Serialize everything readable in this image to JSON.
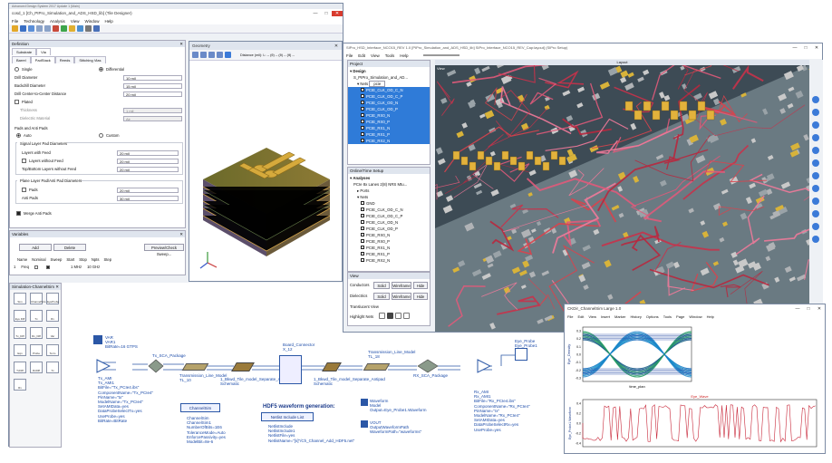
{
  "main": {
    "title": "cosd_1 [Ch_PIPro_Simulation_and_ADS_HSD_lib] (Tile Designer)",
    "app_title": "Advanced Design System 2017 Update 1 (Main)",
    "menu": [
      "File",
      "Technology",
      "Analysis",
      "View",
      "Window",
      "Help"
    ]
  },
  "definition": {
    "header": "Definition",
    "tabs": [
      "Substrate",
      "Via"
    ],
    "subtabs": [
      "Barrel",
      "PadStack",
      "Reeds",
      "Stitching Vias"
    ],
    "single_label": "Single",
    "differential_label": "Differential",
    "drill_diameter_label": "Drill Diameter",
    "drill_diameter_value": "10 mil",
    "backdrill_label": "Backdrill Diameter",
    "backdrill_value": "15 mil",
    "drill_center_label": "Drill Center-to-Center Distance",
    "drill_center_value": "20 mil",
    "plated_label": "Plated",
    "thickness_label": "Thickness",
    "thickness_value": "1 mil",
    "dielectric_label": "Dielectric Material",
    "dielectric_value": "Air",
    "pads_header": "Pads and Anti Pads",
    "auto_label": "Auto",
    "custom_label": "Custom",
    "signal_pads_header": "Signal Layer Pad Diameters",
    "layers_with_feed_label": "Layers with Feed",
    "layers_with_feed_value": "20 mil",
    "layers_without_feed_label": "Layers without Feed",
    "layers_without_feed_value": "20 mil",
    "topbottom_label": "Top/Bottom Layers without Feed",
    "topbottom_value": "20 mil",
    "plane_header": "Plane Layer Pad/Anti Pad Diameters",
    "pads_label": "Pads",
    "pads_value": "20 mil",
    "antipads_label": "Anti Pads",
    "antipads_value": "30 mil",
    "merge_label": "Merge Anti Pads"
  },
  "variables": {
    "header": "Variables",
    "add_label": "Add",
    "delete_label": "Delete",
    "preview_label": "Preview/Check Sweep...",
    "columns": [
      "Name",
      "Nominal",
      "Sweep",
      "Start",
      "Stop",
      "Npts",
      "Step"
    ],
    "row": [
      "Freq",
      "",
      "",
      "1 MHz",
      "10 GHz",
      "",
      " "
    ]
  },
  "palette": {
    "header": "Simulation-ChannelSim",
    "items": [
      "Sim",
      "ChannelSim",
      "EyeProbe",
      "Eye Diff",
      "Tx",
      "Rx",
      "Tx_Diff",
      "Rx_Diff",
      "Var",
      "Eqn",
      "Probe",
      "Term",
      "TxDiff",
      "RxDiff",
      "Tx",
      "Rx"
    ]
  },
  "schematic": {
    "var_block": "VAR\nVAR1\nBitRate=16 GTPS",
    "tx_label": "Tx_AMI\nTx_AMI1\nBitFile=\"Tx_PCIe4.ibs\"\nComponentName=\"Tx_PCIe4\"\nPinName=\"tx\"\nModelName=\"Tx_PCIe4\"\nSetAMIData=yes\nDataProbeSelectTx=yes\nUseProbe=yes\nBitRate=BitRate",
    "tx_pkg": "Tx_SCA_Package",
    "tl1": "Transmission_Line_Model\nTL_10",
    "tl1b": "Transmission_Line_Model\nTL_3",
    "bwd_left": "1_Bkwd_Tile_model_Separate_Antipad\nSchematic",
    "board": "Board_Connector\nX_12",
    "bwd_right": "1_Bkwd_Tile_model_Separate_Antipad\nSchematic",
    "tl2": "Transmission_Line_Model\nTL_18",
    "rx_pkg": "RX_SCA_Package",
    "eye_probe": "Eye_Probe\nEye_Probe1",
    "rx_label": "Rx_AMI\nRx_AMI1\nBitFile=\"Rx_PCIe4.ibs\"\nComponentName=\"Rx_PCIe4\"\nPinName=\"rx\"\nModelName=\"Rx_PCIe4\"\nSetAMIData=yes\nDataProbeSelectRx=yes\nUseProbe=yes",
    "channelsim_btn": "ChannelSim",
    "channelsim_label": "ChannelSim\nChannelSim1\nNumberOfBits=1E6\nToleranceMode=Auto\nEnforcePassivity=yes\nModelBit=8e-6",
    "hdf5_title": "HDF5 waveform generation:",
    "netlist_btn": "Netlist Include List",
    "netlist_label": "NetlistInclude\nNetlistInclude1\nNetlistFile=yes\nNetlistName=\"[s]\"/Ch_Channel_Add_HDF5.net\"",
    "waveform_label": "Waveform\nModel\nOutput=Eye_Probe1.Waveform",
    "vout_label": "VOUT\nOutputWaveformPath\nWaveformPath=\"waveforms\""
  },
  "geometry": {
    "title": "Geometry",
    "distance_label": "Distance (mil): L: -- (θ) -- (θ) -- (θ) --"
  },
  "layout": {
    "title": "SIPro_HSD_Interface_NCO15_REV 1.0 [PIPro_Simulation_and_ADS_HSD_lib] SIPro_Interface_NCO15_REV_Cap:layout] (SIPro Setup)",
    "menu": [
      "File",
      "Edit",
      "View",
      "Tools",
      "Help"
    ],
    "project_header": "Project",
    "design_label": "Design",
    "design_child": "S_PIPro_Simulation_and_AD...",
    "nets_label": "Nets",
    "search_placeholder": "pcie",
    "nets": [
      "PCIE_CLK_OD_C_N",
      "PCIE_CLK_OD_C_P",
      "PCIE_CLK_OD_N",
      "PCIE_CLK_OD_P",
      "PCIE_RX0_N",
      "PCIE_RX0_P",
      "PCIE_RX1_N",
      "PCIE_RX1_P",
      "PCIE_RX2_N"
    ],
    "analyses_header": "Online/Time Setup",
    "analyses_label": "Analyses",
    "analysis_child": "PCIe 8x Lanes 2(8) NRS Mtu...",
    "ports_label": "Ports",
    "nets2_label": "Nets",
    "nets2": [
      "GND",
      "PCIE_CLK_OD_C_N",
      "PCIE_CLK_OD_C_P",
      "PCIE_CLK_OD_N",
      "PCIE_CLK_OD_P",
      "PCIE_RX0_N",
      "PCIE_RX0_P",
      "PCIE_RX1_N",
      "PCIE_RX1_P",
      "PCIE_RX2_N"
    ],
    "view_header": "View",
    "conductors_label": "Conductors",
    "dielectrics_label": "Dielectrics",
    "solid_label": "Solid",
    "wireframe_label": "Wireframe",
    "hide_label": "Hide",
    "translucent_label": "Translucent View",
    "highlight_label": "Highlight Nets",
    "canvas_header": "Layout",
    "view_tab": "View"
  },
  "eye": {
    "title": "CKDir_ChannelSim Large 1.0",
    "menu": [
      "File",
      "Edit",
      "View",
      "Insert",
      "Marker",
      "History",
      "Options",
      "Tools",
      "Page",
      "Window",
      "Help"
    ],
    "eye_xlabel": "time_plan",
    "eye_ylabel": "Eye_Density",
    "eye_yticks": [
      "0.3",
      "0.2",
      "0.1",
      "0.0",
      "-0.1",
      "-0.2",
      "-0.3"
    ],
    "wave_title": "Eye_Wave",
    "wave_ylabel": "Eye_Probe1.Waveform",
    "wave_yticks": [
      "0.4",
      "0.2",
      "0.0",
      "-0.2",
      "-0.4"
    ]
  }
}
